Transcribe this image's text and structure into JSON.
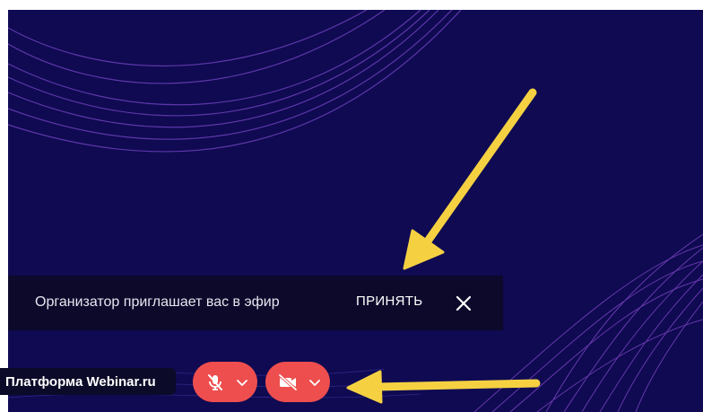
{
  "toast": {
    "message": "Организатор приглашает вас в эфир",
    "accept_label": "ПРИНЯТЬ"
  },
  "platform": {
    "label": "Платформа Webinar.ru"
  },
  "controls": {
    "mic_state": "muted",
    "camera_state": "off"
  },
  "colors": {
    "background": "#0f0a52",
    "control_red": "#ee4e4e",
    "annotation_arrow": "#f5d142",
    "toast_bg": "#0c0a28"
  },
  "icons": {
    "close": "close-icon",
    "mic": "mic-off-icon",
    "camera": "camera-off-icon",
    "chevron": "chevron-down-icon"
  }
}
